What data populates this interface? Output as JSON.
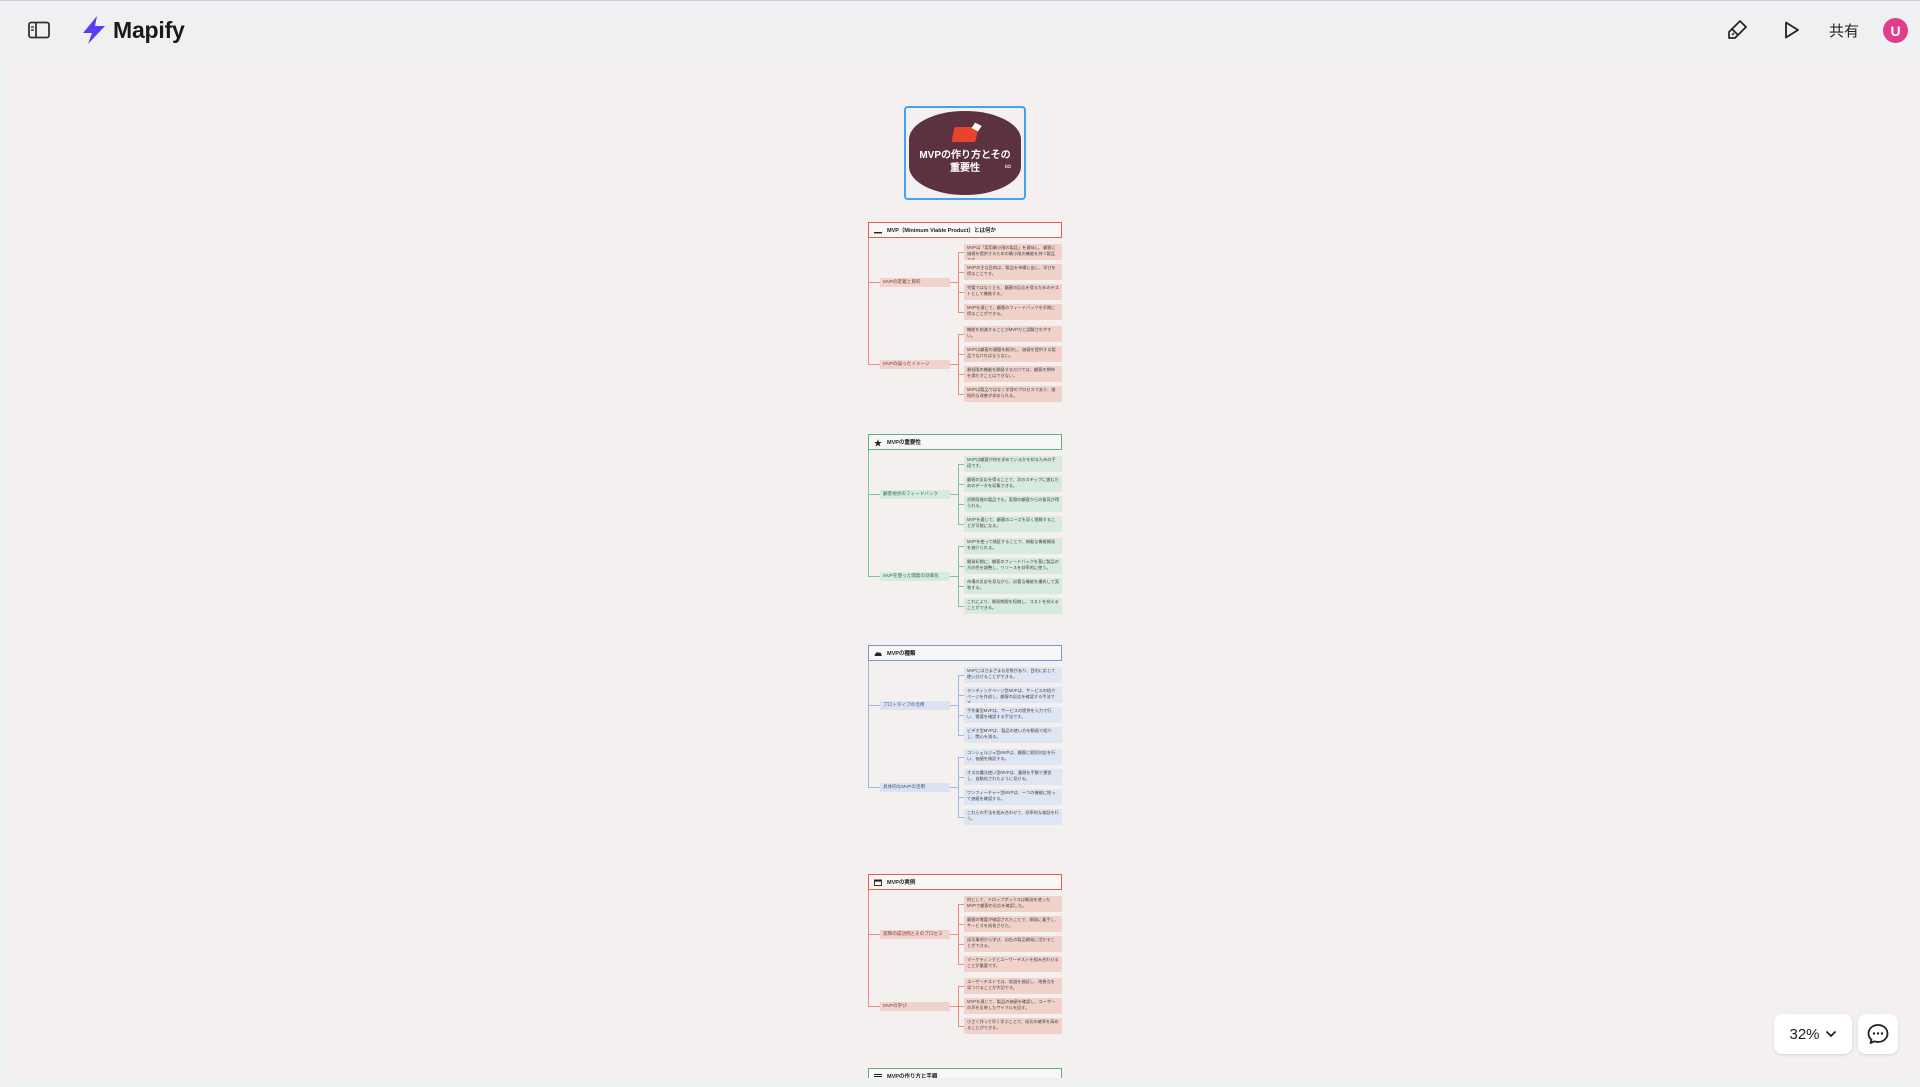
{
  "header": {
    "app_name": "Mapify",
    "share_label": "共有",
    "avatar_initial": "U",
    "brand_color": "#5b3cf0",
    "avatar_color": "#e23d8b"
  },
  "mindmap": {
    "root": {
      "title": "MVPの作り方とその重要性",
      "emoji": "red-flag",
      "color": "#5c3241"
    },
    "sections": [
      {
        "title": "MVP（Minimum Viable Product）とは何か",
        "icon": "underline-icon",
        "theme": "red",
        "branches": [
          {
            "label": "MVPの定義と目的",
            "leaves": [
              "MVPは「実用最小限の製品」を意味し、顧客に価値を提供するための最小限の機能を持つ製品です。",
              "MVPの主な目的は、製品を市場に出し、学びを得ることです。",
              "完璧ではなくとも、顧客の反応を得るためのテストとして機能する。",
              "MVPを通じて、顧客のフィードバックを早期に得ることができる。"
            ]
          },
          {
            "label": "MVPの誤ったイメージ",
            "leaves": [
              "機能を削減することがMVPだと誤解されやすい。",
              "MVPは顧客の課題を解決し、価値を提供する製品でなければならない。",
              "最低限の機能を開発するだけでは、顧客の期待を満たすことはできない。",
              "MVPは製品ではなく学習のプロセスであり、継続的な改善が求められる。"
            ]
          }
        ]
      },
      {
        "title": "MVPの重要性",
        "icon": "star-icon",
        "theme": "green",
        "branches": [
          {
            "label": "顧客視点のフィードバック",
            "leaves": [
              "MVPは顧客が何を求めているかを知るための手段です。",
              "顧客の反応を得ることで、次のステップに進むためのデータを収集できる。",
              "初期段階の製品でも、実際の顧客からの意見が得られる。",
              "MVPを通じて、顧客のニーズを深く理解することが可能になる。"
            ]
          },
          {
            "label": "MVPを使った開発の効率化",
            "leaves": [
              "MVPを使って検証することで、無駄な機能開発を避けられる。",
              "開発初期に、顧客のフィードバックを基に製品の方向性を調整し、リソースを効率的に使う。",
              "市場の反応を見ながら、必要な機能を優先して実装する。",
              "これにより、開発期間を短縮し、コストを抑えることができる。"
            ]
          }
        ]
      },
      {
        "title": "MVPの種類",
        "icon": "cloud-icon",
        "theme": "blue",
        "branches": [
          {
            "label": "プロトタイプの活用",
            "leaves": [
              "MVPにはさまざまな形態があり、目的に応じて使い分けることができる。",
              "ランディングページ型MVPは、サービスの紹介ページを作成し、顧客の反応を確認する手法です。",
              "手作業型MVPは、サービスの提供を人力で行い、需要を確認する手法です。",
              "ビデオ型MVPは、製品の使い方を動画で紹介し、関心を測る。"
            ]
          },
          {
            "label": "具体的なMVPの活用",
            "leaves": [
              "コンシェルジュ型MVPは、顧客に個別対応を行い、価値を検証する。",
              "オズの魔法使い型MVPは、裏側を手動で運営し、自動化されたように見せる。",
              "ワンフィーチャー型MVPは、一つの機能に絞って価値を確認する。",
              "これらの手法を組み合わせて、効率的な検証を行う。"
            ]
          }
        ]
      },
      {
        "title": "MVPの実例",
        "icon": "calendar-icon",
        "theme": "red",
        "branches": [
          {
            "label": "実際の成功例とそのプロセス",
            "leaves": [
              "例として、ドロップボックスは動画を使ったMVPで顧客の反応を確認した。",
              "顧客の需要が確認されたことで、開発に着手し、サービスを成長させた。",
              "成功事例から学び、自社の製品開発に活かすことができる。",
              "マーケティングとユーザーテストを組み合わせることが重要です。"
            ]
          },
          {
            "label": "MVPの学び",
            "leaves": [
              "ユーザーテストでは、仮説を検証し、改善点を見つけることが大切です。",
              "MVPを通じて、製品の価値を確認し、ユーザーの声を反映したサイクルを回す。",
              "小さく作って早く学ぶことで、成功の確率を高めることができる。"
            ]
          }
        ]
      },
      {
        "title": "MVPの作り方と手順",
        "icon": "list-icon",
        "theme": "green",
        "branches": []
      }
    ]
  },
  "zoom": {
    "level": "32%"
  }
}
